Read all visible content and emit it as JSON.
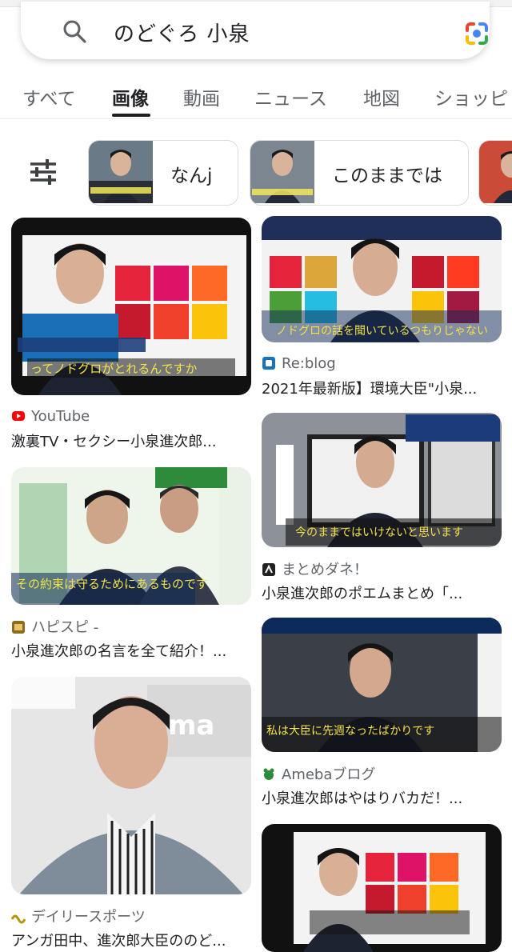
{
  "search": {
    "query": "のどぐろ 小泉"
  },
  "tabs": [
    {
      "label": "すべて"
    },
    {
      "label": "画像"
    },
    {
      "label": "動画"
    },
    {
      "label": "ニュース"
    },
    {
      "label": "地図"
    },
    {
      "label": "ショッピ"
    }
  ],
  "chips": [
    {
      "label": "なんj"
    },
    {
      "label": "このままでは"
    }
  ],
  "results": [
    {
      "source": "YouTube",
      "title": "激裏TV・セクシー小泉進次郎...",
      "overlay": "ってノドグロがとれるんですか",
      "icon": "youtube-icon",
      "icon_color": "#ff0000"
    },
    {
      "source": "Re:blog",
      "title": "2021年最新版】環境大臣\"小泉...",
      "overlay": "ノドグロの話を聞いているつもりじゃない",
      "icon": "reblog-icon",
      "icon_color": "#1a73b8"
    },
    {
      "source": "ハピスピ -",
      "title": "小泉進次郎の名言を全て紹介！...",
      "overlay": "その約束は守るためにあるものです",
      "icon": "hapispi-icon",
      "icon_color": "#8a6d1f"
    },
    {
      "source": "まとめダネ！",
      "title": "小泉進次郎のポエムまとめ「...",
      "overlay": "今のままではいけないと思います",
      "icon": "matomedane-icon",
      "icon_color": "#202124"
    },
    {
      "source": "デイリースポーツ",
      "title": "アンガ田中、進次郎大臣ののど...",
      "overlay": "",
      "icon": "daily-sports-icon",
      "icon_color": "#b59400"
    },
    {
      "source": "Amebaブログ",
      "title": "小泉進次郎はやはりバカだ！...",
      "overlay": "私は大臣に先週なったばかりです",
      "icon": "ameba-icon",
      "icon_color": "#2d8c3c"
    }
  ]
}
